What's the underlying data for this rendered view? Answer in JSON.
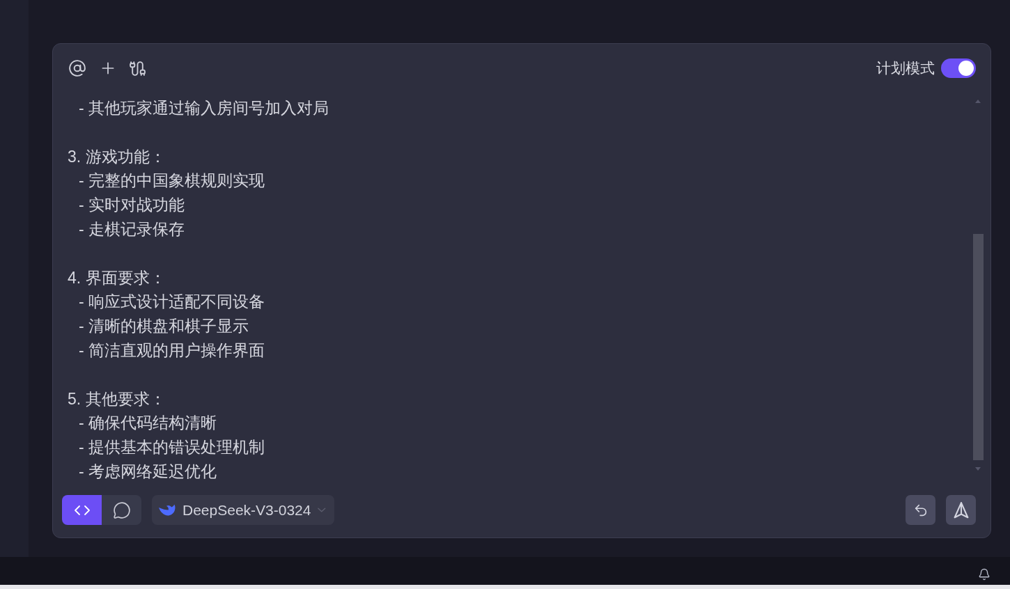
{
  "toolbar": {
    "plan_mode": {
      "label": "计划模式",
      "on": true
    }
  },
  "prompt": {
    "sections": [
      {
        "items": [
          "- 其他玩家通过输入房间号加入对局"
        ]
      },
      {
        "heading": "3. 游戏功能：",
        "items": [
          "- 完整的中国象棋规则实现",
          "- 实时对战功能",
          "- 走棋记录保存"
        ]
      },
      {
        "heading": "4. 界面要求：",
        "items": [
          "- 响应式设计适配不同设备",
          "- 清晰的棋盘和棋子显示",
          "- 简洁直观的用户操作界面"
        ]
      },
      {
        "heading": "5. 其他要求：",
        "items": [
          "- 确保代码结构清晰",
          "- 提供基本的错误处理机制",
          "- 考虑网络延迟优化"
        ]
      }
    ]
  },
  "modes": [
    {
      "kind": "code",
      "selected": true
    },
    {
      "kind": "chat",
      "selected": false
    }
  ],
  "model": {
    "label": "DeepSeek-V3-0324"
  }
}
